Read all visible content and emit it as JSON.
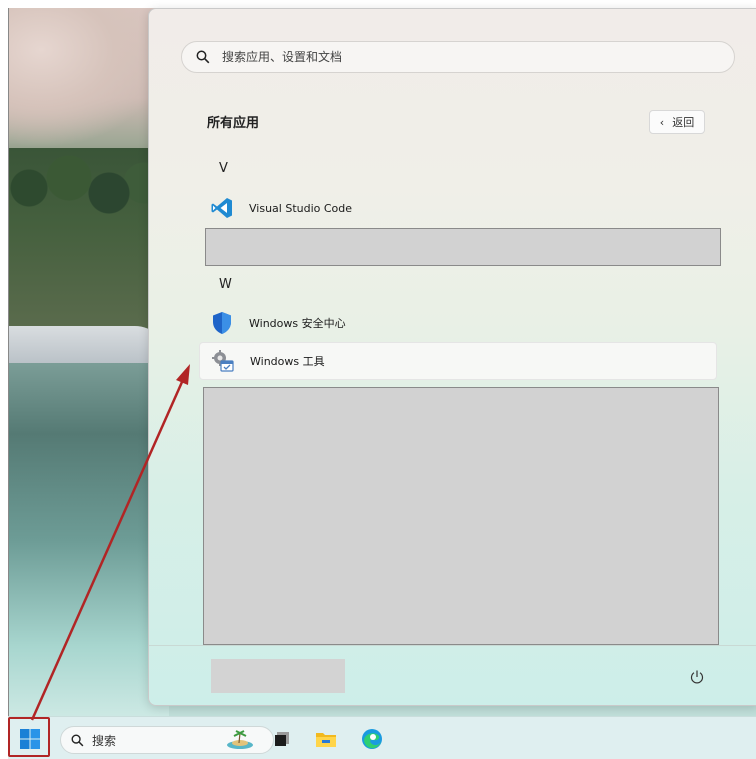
{
  "start_menu": {
    "search_placeholder": "搜索应用、设置和文档",
    "section_title": "所有应用",
    "back_label": "返回",
    "groups": [
      {
        "letter": "V",
        "apps": [
          {
            "label": "Visual Studio Code",
            "icon": "vscode-icon"
          }
        ]
      },
      {
        "letter": "W",
        "apps": [
          {
            "label": "Windows 安全中心",
            "icon": "windows-security-icon"
          },
          {
            "label": "Windows 工具",
            "icon": "windows-tools-icon"
          }
        ]
      }
    ]
  },
  "taskbar": {
    "search_label": "搜索",
    "icons": [
      "start-icon",
      "search-icon",
      "island-widget-icon",
      "task-view-icon",
      "file-explorer-icon",
      "edge-icon"
    ]
  },
  "colors": {
    "annotation": "#b12525",
    "vscode_blue": "#1f8ad2",
    "security_blue": "#1e64c8"
  }
}
